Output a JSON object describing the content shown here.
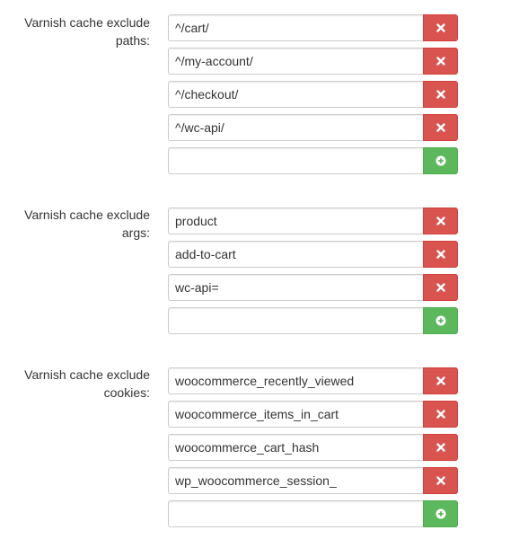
{
  "sections": [
    {
      "label_line1": "Varnish cache exclude",
      "label_line2": "paths:",
      "entries": [
        "^/cart/",
        "^/my-account/",
        "^/checkout/",
        "^/wc-api/"
      ],
      "new_entry": ""
    },
    {
      "label_line1": "Varnish cache exclude",
      "label_line2": "args:",
      "entries": [
        "product",
        "add-to-cart",
        "wc-api="
      ],
      "new_entry": ""
    },
    {
      "label_line1": "Varnish cache exclude",
      "label_line2": "cookies:",
      "entries": [
        "woocommerce_recently_viewed",
        "woocommerce_items_in_cart",
        "woocommerce_cart_hash",
        "wp_woocommerce_session_"
      ],
      "new_entry": ""
    }
  ],
  "icons": {
    "remove": "close-icon",
    "add": "plus-circle-icon"
  },
  "colors": {
    "remove_button": "#d9534f",
    "add_button": "#5cb85c",
    "label_text": "#333333",
    "input_border": "#cccccc"
  }
}
